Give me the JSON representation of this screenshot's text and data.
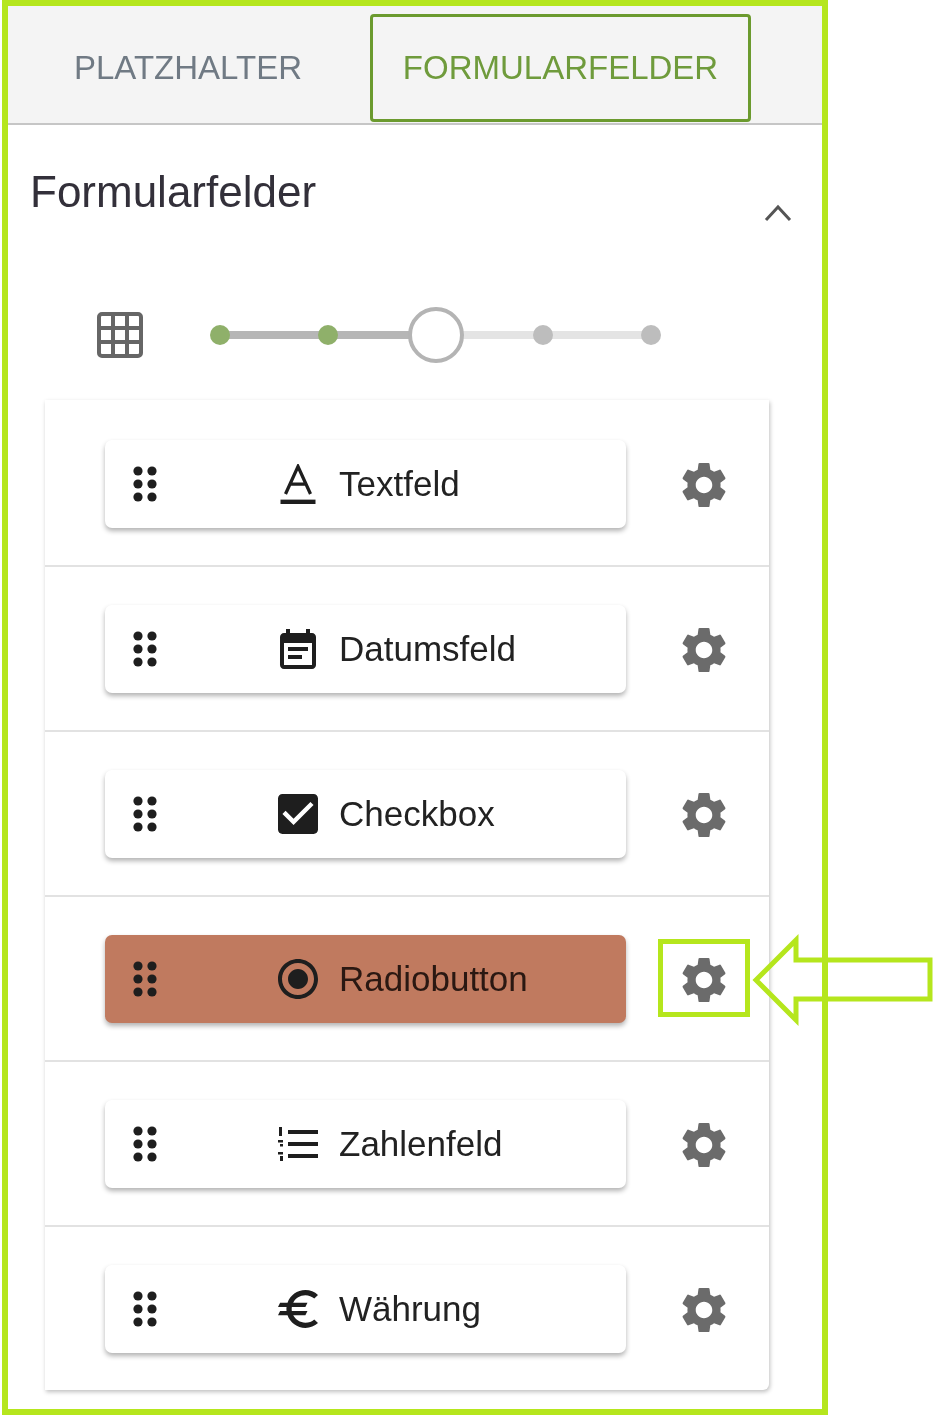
{
  "tabs": [
    {
      "label": "PLATZHALTER",
      "selected": false
    },
    {
      "label": "FORMULARFELDER",
      "selected": true
    }
  ],
  "section": {
    "title": "Formularfelder",
    "expanded": true
  },
  "size_slider": {
    "level": 0.5
  },
  "fields": [
    {
      "kind": "text",
      "label": "Textfeld",
      "selected": false,
      "settings_highlighted": false
    },
    {
      "kind": "date",
      "label": "Datumsfeld",
      "selected": false,
      "settings_highlighted": false
    },
    {
      "kind": "checkbox",
      "label": "Checkbox",
      "selected": false,
      "settings_highlighted": false
    },
    {
      "kind": "radio",
      "label": "Radiobutton",
      "selected": true,
      "settings_highlighted": true
    },
    {
      "kind": "number",
      "label": "Zahlenfeld",
      "selected": false,
      "settings_highlighted": false
    },
    {
      "kind": "currency",
      "label": "Währung",
      "selected": false,
      "settings_highlighted": false
    }
  ]
}
